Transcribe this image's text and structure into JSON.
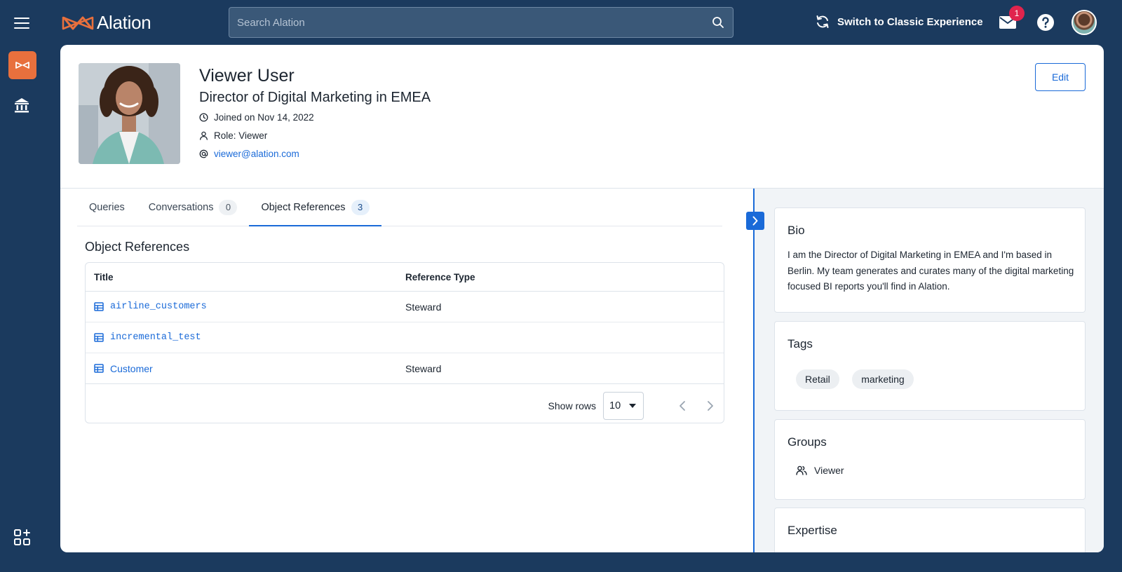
{
  "app": {
    "logo_text": "Alation",
    "search_placeholder": "Search Alation",
    "switch_label": "Switch to Classic Experience",
    "mail_badge": "1"
  },
  "profile": {
    "name": "Viewer User",
    "title": "Director of Digital Marketing in EMEA",
    "joined": "Joined on Nov 14, 2022",
    "role": "Role: Viewer",
    "email": "viewer@alation.com",
    "edit_label": "Edit"
  },
  "tabs": [
    {
      "label": "Queries",
      "count": ""
    },
    {
      "label": "Conversations",
      "count": "0"
    },
    {
      "label": "Object References",
      "count": "3"
    }
  ],
  "object_references": {
    "heading": "Object References",
    "columns": [
      "Title",
      "Reference Type"
    ],
    "rows": [
      {
        "title": "airline_customers",
        "type": "Steward"
      },
      {
        "title": "incremental_test",
        "type": ""
      },
      {
        "title": "Customer",
        "type": "Steward"
      }
    ],
    "show_rows_label": "Show rows",
    "rows_value": "10"
  },
  "sidebar": {
    "bio_title": "Bio",
    "bio_text": "I am the Director of Digital Marketing in EMEA and I'm based in Berlin. My team generates and curates many of the digital marketing focused BI reports you'll find in Alation.",
    "tags_title": "Tags",
    "tags": [
      "Retail",
      "marketing"
    ],
    "groups_title": "Groups",
    "groups": [
      "Viewer"
    ],
    "expertise_title": "Expertise"
  },
  "colors": {
    "nav_bg": "#1b3a5e",
    "accent": "#1a6ad8",
    "brand_orange": "#e8703d",
    "badge_red": "#e0244d"
  }
}
